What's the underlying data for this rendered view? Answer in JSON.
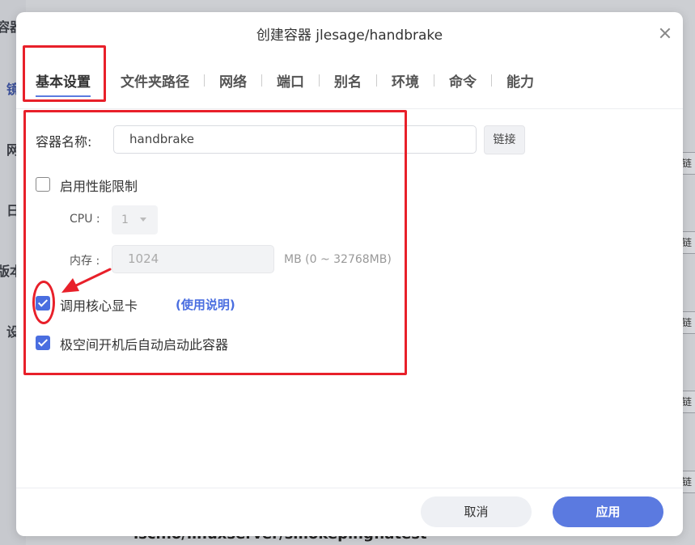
{
  "background": {
    "sidebar_fragments": [
      "容器",
      "镜",
      "网",
      "日",
      "版本",
      "设"
    ],
    "side_link_label": "链接",
    "bottom_text": "lscr.io/linuxserver/smokeping:latest"
  },
  "dialog": {
    "title": "创建容器 jlesage/handbrake",
    "tabs": [
      {
        "label": "基本设置",
        "active": true
      },
      {
        "label": "文件夹路径",
        "active": false
      },
      {
        "label": "网络",
        "active": false
      },
      {
        "label": "端口",
        "active": false
      },
      {
        "label": "别名",
        "active": false
      },
      {
        "label": "环境",
        "active": false
      },
      {
        "label": "命令",
        "active": false
      },
      {
        "label": "能力",
        "active": false
      }
    ],
    "container_name_label": "容器名称:",
    "container_name_value": "handbrake",
    "link_button": "链接",
    "perf_limit": {
      "label": "启用性能限制",
      "checked": false
    },
    "cpu": {
      "label": "CPU :",
      "value": "1"
    },
    "memory": {
      "label": "内存 :",
      "placeholder": "1024",
      "hint": "MB (0 ~ 32768MB)"
    },
    "gpu": {
      "label": "调用核心显卡",
      "checked": true,
      "help": "(使用说明)"
    },
    "autostart": {
      "label": "极空间开机后自动启动此容器",
      "checked": true
    },
    "cancel_button": "取消",
    "apply_button": "应用"
  },
  "colors": {
    "accent": "#5b7ae0",
    "checkbox_on": "#4a6ee0",
    "annotation": "#e8202a"
  }
}
